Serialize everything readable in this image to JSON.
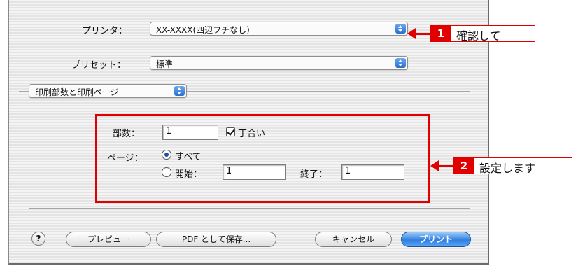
{
  "printer": {
    "label": "プリンタ：",
    "value": "XX-XXXX(四辺フチなし)"
  },
  "preset": {
    "label": "プリセット：",
    "value": "標準"
  },
  "panel": {
    "value": "印刷部数と印刷ページ"
  },
  "copies": {
    "label": "部数：",
    "value": "1",
    "collate_label": "丁合い"
  },
  "pages": {
    "label": "ページ：",
    "all_label": "すべて",
    "from_label": "開始：",
    "from_value": "1",
    "to_label": "終了：",
    "to_value": "1"
  },
  "buttons": {
    "help": "?",
    "preview": "プレビュー",
    "save_pdf": "PDF として保存...",
    "cancel": "キャンセル",
    "print": "プリント"
  },
  "callouts": [
    {
      "num": "1",
      "text": "確認して"
    },
    {
      "num": "2",
      "text": "設定します"
    }
  ],
  "colors": {
    "accent_red": "#e00000",
    "default_button": "#2f7fe0"
  }
}
